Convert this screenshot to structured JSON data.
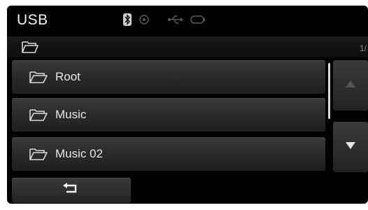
{
  "header": {
    "title": "USB",
    "status_icons": [
      "bluetooth-icon",
      "record-icon",
      "usb-icon",
      "battery-icon"
    ]
  },
  "path_bar": {
    "icon": "folder-open-icon",
    "page_indicator": "1/"
  },
  "list": {
    "items": [
      {
        "label": "Root",
        "icon": "folder-open-icon"
      },
      {
        "label": "Music",
        "icon": "folder-open-icon"
      },
      {
        "label": "Music 02",
        "icon": "folder-open-icon"
      }
    ]
  },
  "scroll": {
    "up_icon": "arrow-up-icon",
    "down_icon": "arrow-down-icon",
    "up_enabled": false,
    "down_enabled": true
  },
  "footer": {
    "back_icon": "return-icon"
  },
  "colors": {
    "screen_bg": "#000000",
    "row_bg": "#2e2e2e",
    "text": "#e8e8e8",
    "disabled_icon": "#555555"
  }
}
